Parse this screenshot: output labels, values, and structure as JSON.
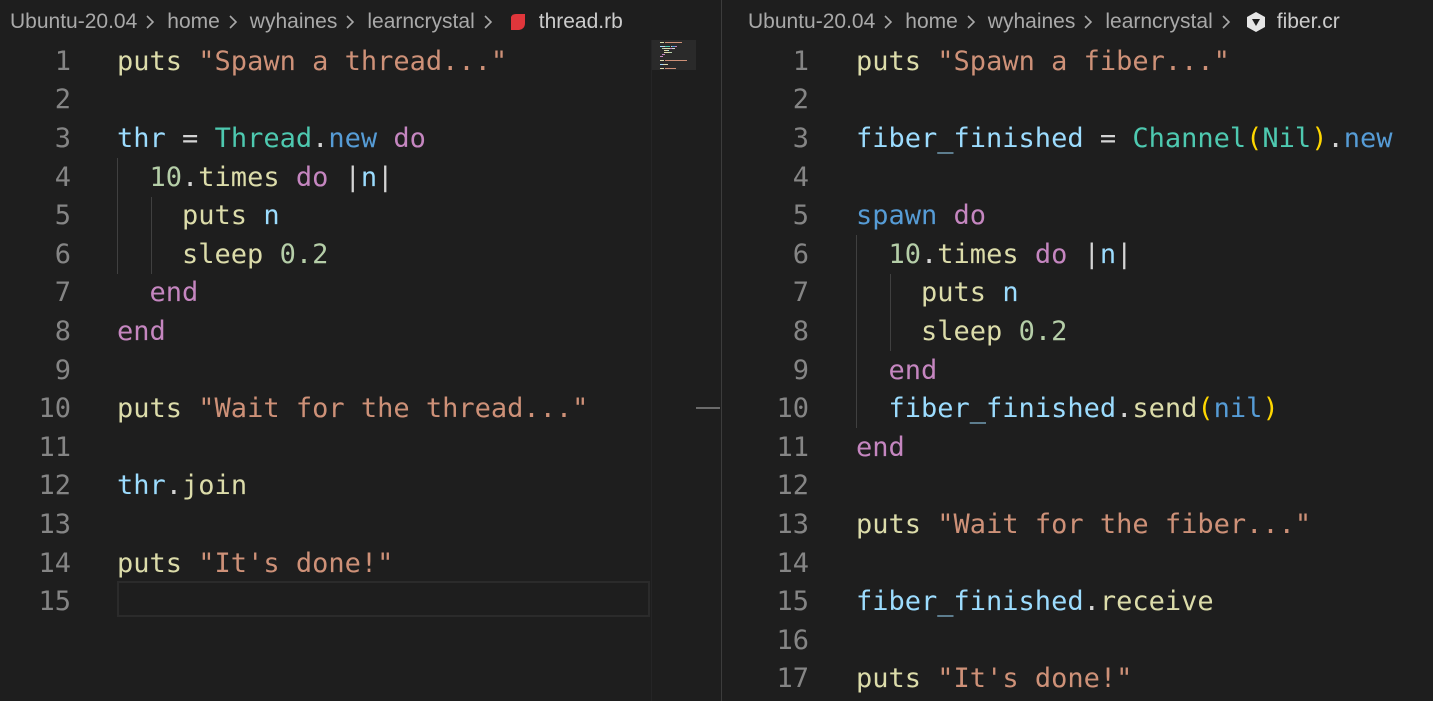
{
  "left": {
    "breadcrumb": [
      "Ubuntu-20.04",
      "home",
      "wyhaines",
      "learncrystal"
    ],
    "file": "thread.rb",
    "file_icon": "ruby-icon",
    "lines": [
      {
        "n": "1",
        "tokens": [
          [
            "f",
            "puts"
          ],
          [
            "p",
            " "
          ],
          [
            "s",
            "\"Spawn a thread...\""
          ]
        ]
      },
      {
        "n": "2",
        "tokens": []
      },
      {
        "n": "3",
        "tokens": [
          [
            "v",
            "thr"
          ],
          [
            "p",
            " = "
          ],
          [
            "t",
            "Thread"
          ],
          [
            "p",
            "."
          ],
          [
            "b",
            "new"
          ],
          [
            "p",
            " "
          ],
          [
            "k",
            "do"
          ]
        ]
      },
      {
        "n": "4",
        "tokens": [
          [
            "p",
            "  "
          ],
          [
            "n",
            "10"
          ],
          [
            "p",
            "."
          ],
          [
            "f",
            "times"
          ],
          [
            "p",
            " "
          ],
          [
            "k",
            "do"
          ],
          [
            "p",
            " |"
          ],
          [
            "v",
            "n"
          ],
          [
            "p",
            "|"
          ]
        ]
      },
      {
        "n": "5",
        "tokens": [
          [
            "p",
            "    "
          ],
          [
            "f",
            "puts"
          ],
          [
            "p",
            " "
          ],
          [
            "v",
            "n"
          ]
        ]
      },
      {
        "n": "6",
        "tokens": [
          [
            "p",
            "    "
          ],
          [
            "f",
            "sleep"
          ],
          [
            "p",
            " "
          ],
          [
            "n",
            "0.2"
          ]
        ]
      },
      {
        "n": "7",
        "tokens": [
          [
            "p",
            "  "
          ],
          [
            "k",
            "end"
          ]
        ]
      },
      {
        "n": "8",
        "tokens": [
          [
            "k",
            "end"
          ]
        ]
      },
      {
        "n": "9",
        "tokens": []
      },
      {
        "n": "10",
        "tokens": [
          [
            "f",
            "puts"
          ],
          [
            "p",
            " "
          ],
          [
            "s",
            "\"Wait for the thread...\""
          ]
        ]
      },
      {
        "n": "11",
        "tokens": []
      },
      {
        "n": "12",
        "tokens": [
          [
            "v",
            "thr"
          ],
          [
            "p",
            "."
          ],
          [
            "f",
            "join"
          ]
        ]
      },
      {
        "n": "13",
        "tokens": []
      },
      {
        "n": "14",
        "tokens": [
          [
            "f",
            "puts"
          ],
          [
            "p",
            " "
          ],
          [
            "s",
            "\"It's done!\""
          ]
        ]
      },
      {
        "n": "15",
        "tokens": []
      }
    ]
  },
  "right": {
    "breadcrumb": [
      "Ubuntu-20.04",
      "home",
      "wyhaines",
      "learncrystal"
    ],
    "file": "fiber.cr",
    "file_icon": "crystal-icon",
    "lines": [
      {
        "n": "1",
        "tokens": [
          [
            "f",
            "puts"
          ],
          [
            "p",
            " "
          ],
          [
            "s",
            "\"Spawn a fiber...\""
          ]
        ]
      },
      {
        "n": "2",
        "tokens": []
      },
      {
        "n": "3",
        "tokens": [
          [
            "v",
            "fiber_finished"
          ],
          [
            "p",
            " = "
          ],
          [
            "t",
            "Channel"
          ],
          [
            "y",
            "("
          ],
          [
            "t",
            "Nil"
          ],
          [
            "y",
            ")"
          ],
          [
            "p",
            "."
          ],
          [
            "b",
            "new"
          ]
        ]
      },
      {
        "n": "4",
        "tokens": []
      },
      {
        "n": "5",
        "tokens": [
          [
            "b",
            "spawn"
          ],
          [
            "p",
            " "
          ],
          [
            "k",
            "do"
          ]
        ]
      },
      {
        "n": "6",
        "tokens": [
          [
            "p",
            "  "
          ],
          [
            "n",
            "10"
          ],
          [
            "p",
            "."
          ],
          [
            "f",
            "times"
          ],
          [
            "p",
            " "
          ],
          [
            "k",
            "do"
          ],
          [
            "p",
            " |"
          ],
          [
            "v",
            "n"
          ],
          [
            "p",
            "|"
          ]
        ]
      },
      {
        "n": "7",
        "tokens": [
          [
            "p",
            "    "
          ],
          [
            "f",
            "puts"
          ],
          [
            "p",
            " "
          ],
          [
            "v",
            "n"
          ]
        ]
      },
      {
        "n": "8",
        "tokens": [
          [
            "p",
            "    "
          ],
          [
            "f",
            "sleep"
          ],
          [
            "p",
            " "
          ],
          [
            "n",
            "0.2"
          ]
        ]
      },
      {
        "n": "9",
        "tokens": [
          [
            "p",
            "  "
          ],
          [
            "k",
            "end"
          ]
        ]
      },
      {
        "n": "10",
        "tokens": [
          [
            "p",
            "  "
          ],
          [
            "v",
            "fiber_finished"
          ],
          [
            "p",
            "."
          ],
          [
            "f",
            "send"
          ],
          [
            "y",
            "("
          ],
          [
            "b",
            "nil"
          ],
          [
            "y",
            ")"
          ]
        ]
      },
      {
        "n": "11",
        "tokens": [
          [
            "k",
            "end"
          ]
        ]
      },
      {
        "n": "12",
        "tokens": []
      },
      {
        "n": "13",
        "tokens": [
          [
            "f",
            "puts"
          ],
          [
            "p",
            " "
          ],
          [
            "s",
            "\"Wait for the fiber...\""
          ]
        ]
      },
      {
        "n": "14",
        "tokens": []
      },
      {
        "n": "15",
        "tokens": [
          [
            "v",
            "fiber_finished"
          ],
          [
            "p",
            "."
          ],
          [
            "f",
            "receive"
          ]
        ]
      },
      {
        "n": "16",
        "tokens": []
      },
      {
        "n": "17",
        "tokens": [
          [
            "f",
            "puts"
          ],
          [
            "p",
            " "
          ],
          [
            "s",
            "\"It's done!\""
          ]
        ]
      }
    ]
  },
  "colors": {
    "background": "#1e1e1e",
    "keyword": "#c586c0",
    "string": "#ce9178",
    "type": "#4ec9b0",
    "variable": "#9cdcfe",
    "function": "#dcdcaa",
    "number": "#b5cea8",
    "builtin": "#569cd6",
    "bracket": "#ffd700",
    "line_number": "#858585",
    "ruby_icon": "#e0363b",
    "crystal_icon": "#e6e6e6"
  }
}
